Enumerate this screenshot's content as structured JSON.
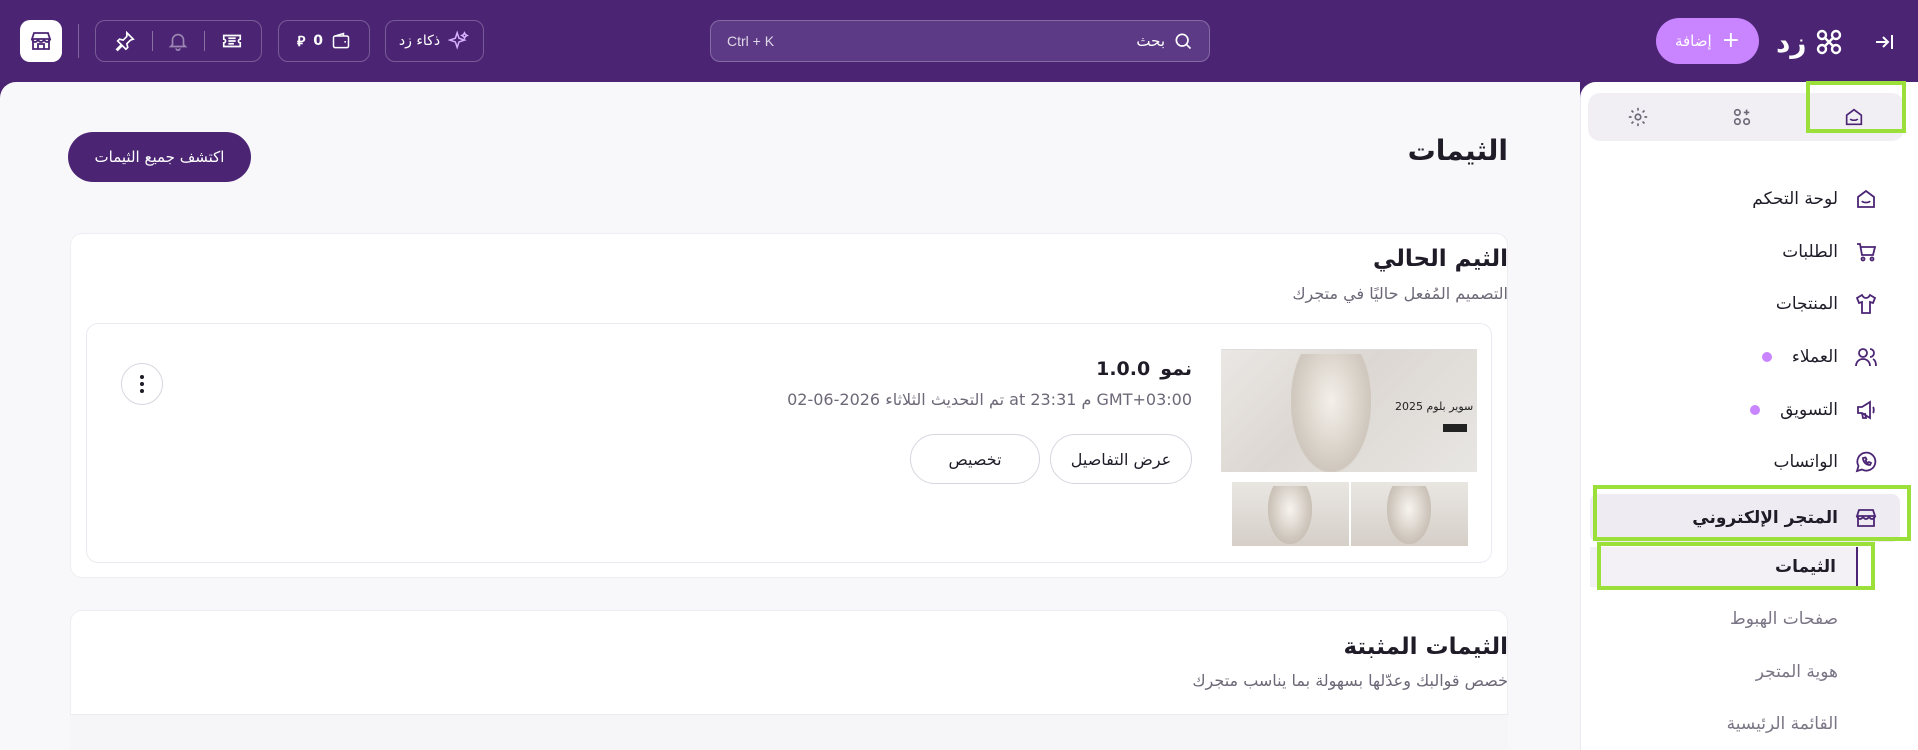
{
  "topbar": {
    "add_label": "إضافة",
    "logo_text": "زد",
    "search_label": "بحث",
    "search_shortcut": "Ctrl + K",
    "ai_label": "ذكاء زد",
    "wallet_amount": "0"
  },
  "sidebar": {
    "nav": [
      {
        "label": "لوحة التحكم",
        "icon": "home-icon"
      },
      {
        "label": "الطلبات",
        "icon": "cart-icon"
      },
      {
        "label": "المنتجات",
        "icon": "shirt-icon"
      },
      {
        "label": "العملاء",
        "icon": "users-icon"
      },
      {
        "label": "التسويق",
        "icon": "megaphone-icon"
      },
      {
        "label": "الواتساب",
        "icon": "whatsapp-icon"
      },
      {
        "label": "المتجر الإلكتروني",
        "icon": "store-icon"
      }
    ],
    "sub": [
      {
        "label": "الثيمات"
      },
      {
        "label": "صفحات الهبوط"
      },
      {
        "label": "هوية المتجر"
      },
      {
        "label": "القائمة الرئيسية"
      }
    ]
  },
  "main": {
    "page_title": "الثيمات",
    "discover_label": "اكتشف جميع الثيمات",
    "current": {
      "title": "الثيم الحالي",
      "subtitle": "التصميم المُفعل حاليًا في متجرك",
      "theme_name": "نمو",
      "theme_version": "1.0.0",
      "updated": "تم التحديث الثلاثاء 2026-06-02 at 23:31 م GMT+03:00",
      "details_label": "عرض التفاصيل",
      "customize_label": "تخصيص",
      "preview_text": "سوير بلوم 2025"
    },
    "installed": {
      "title": "الثيمات المثبتة",
      "subtitle": "خصص قوالبك وعدّلها بسهولة بما يناسب متجرك"
    }
  },
  "colors": {
    "brand": "#4b2574",
    "accent": "#c984ff",
    "highlight": "#9be03a"
  }
}
